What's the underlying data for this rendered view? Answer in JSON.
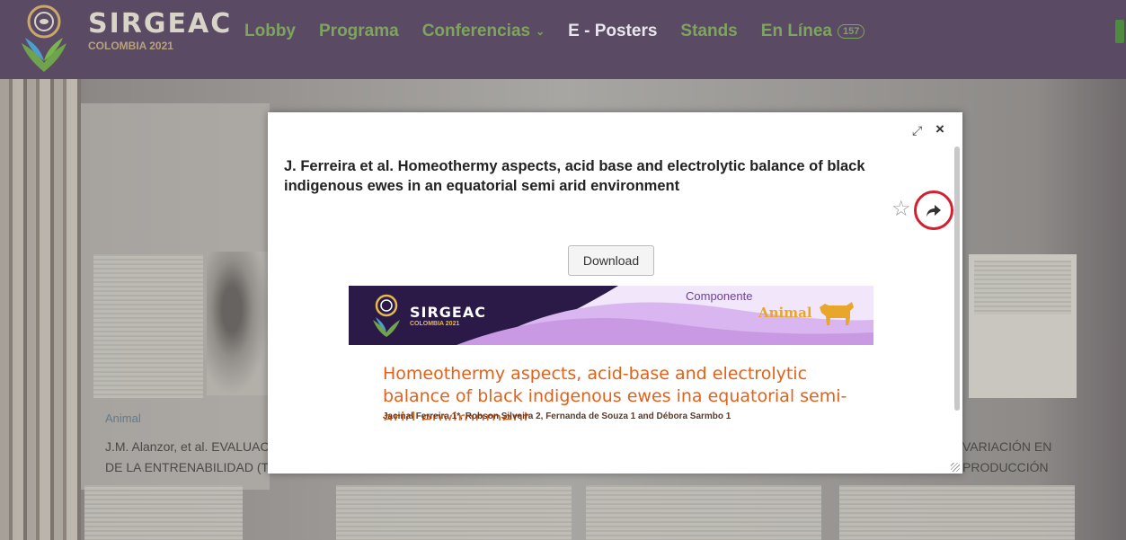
{
  "nav": {
    "brand": "SIRGEAC",
    "brand_sub": "COLOMBIA 2021",
    "links": {
      "lobby": "Lobby",
      "programa": "Programa",
      "conferencias": "Conferencias",
      "eposters": "E - Posters",
      "stands": "Stands",
      "enlinea": "En Línea",
      "online_count": "157"
    }
  },
  "background": {
    "card_category": "Animal",
    "card_title_left": "J.M. Alanzor, et al. EVALUACIÓN\nDE LA ENTRENABILIDAD (T",
    "card_title_right": "VARIACIÓN EN\nPRODUCCIÓN"
  },
  "modal": {
    "title": "J. Ferreira et al. Homeothermy aspects, acid base and electrolytic balance of black indigenous ewes in an equatorial semi arid environment",
    "download_label": "Download",
    "poster": {
      "brand": "SIRGEAC",
      "brand_sub": "COLOMBIA 2021",
      "componente": "Componente",
      "animal": "Animal",
      "title": "Homeothermy aspects, acid-base and electrolytic balance of black indigenous ewes ina equatorial semi-arid environment",
      "authors": "Jacinal Ferreira 1*, Robson Silveira 2, Fernanda de Souza 1 and Débora Sarmbo 1"
    }
  },
  "colors": {
    "navbar": "#5b4a63",
    "nav_link": "#7ea45f",
    "highlight": "#d42030",
    "poster_title": "#e0621b"
  }
}
